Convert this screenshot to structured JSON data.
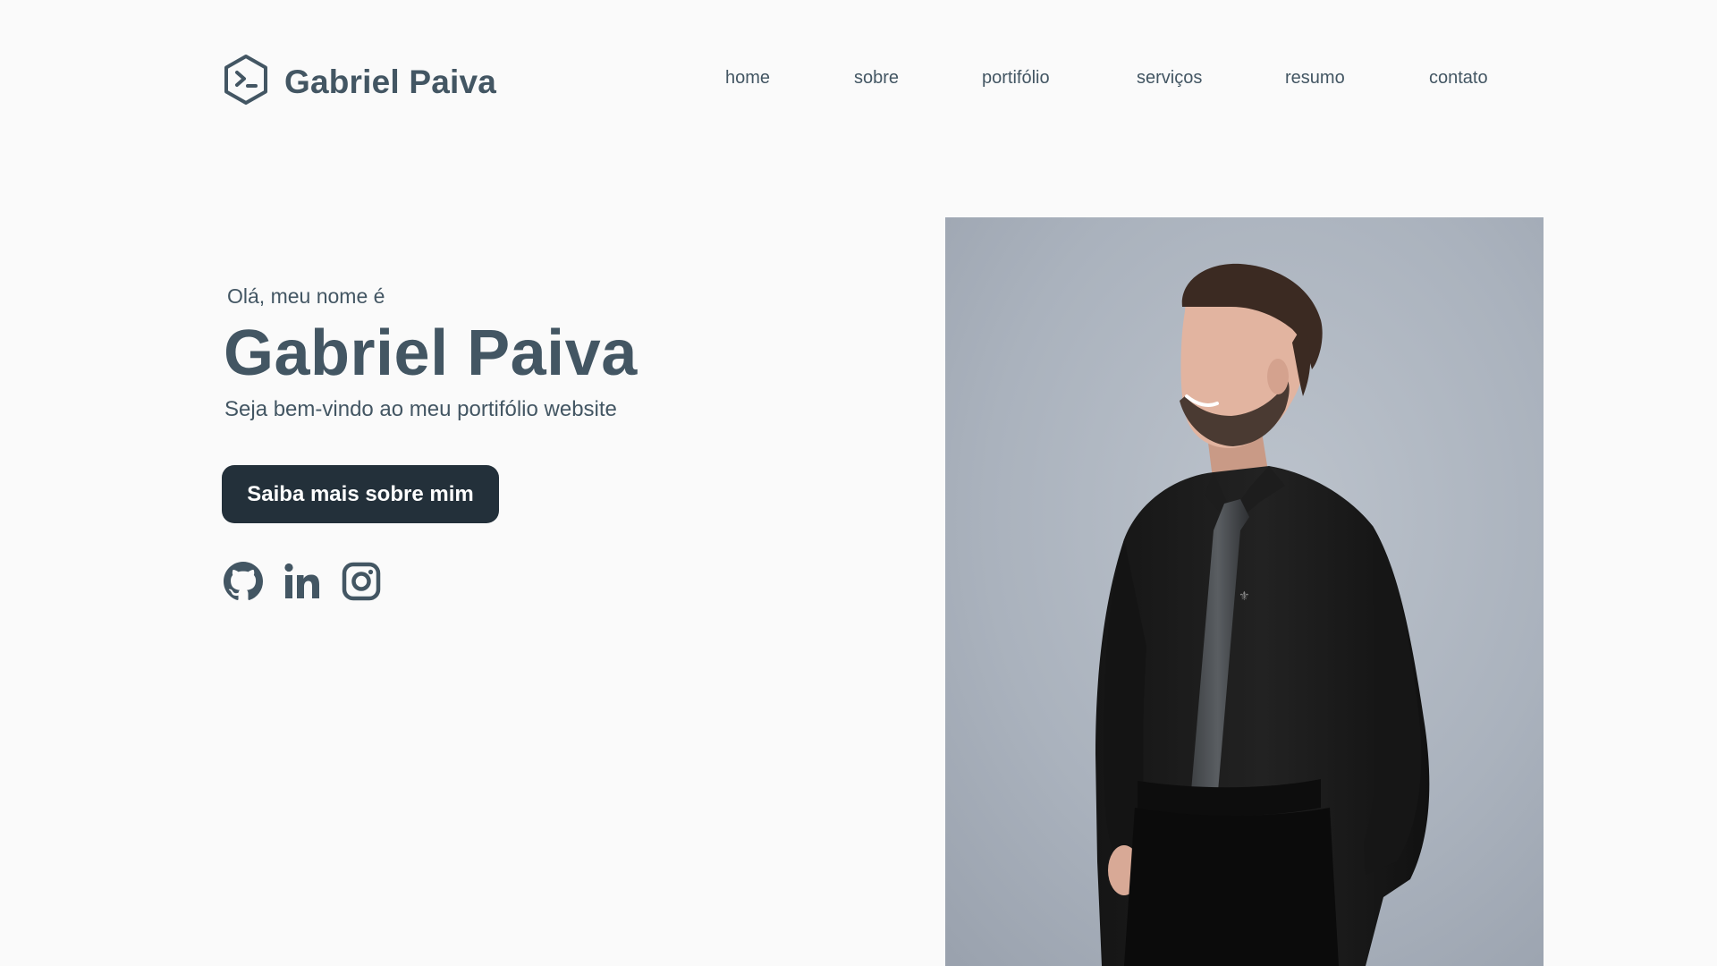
{
  "header": {
    "logo_text": "Gabriel Paiva",
    "logo_icon": "terminal-hexagon-icon",
    "nav": [
      {
        "label": "home"
      },
      {
        "label": "sobre"
      },
      {
        "label": "portifólio"
      },
      {
        "label": "serviços"
      },
      {
        "label": "resumo"
      },
      {
        "label": "contato"
      }
    ]
  },
  "hero": {
    "greeting": "Olá, meu nome é",
    "name": "Gabriel Paiva",
    "tagline": "Seja bem-vindo ao meu portifólio website",
    "cta_label": "Saiba mais sobre mim",
    "socials": [
      {
        "icon": "github-icon"
      },
      {
        "icon": "linkedin-icon"
      },
      {
        "icon": "instagram-icon"
      }
    ]
  },
  "profile_photo": {
    "alt": "Gabriel Paiva"
  },
  "colors": {
    "text": "#435663",
    "button_bg": "#23303a",
    "background": "#fafafa"
  }
}
